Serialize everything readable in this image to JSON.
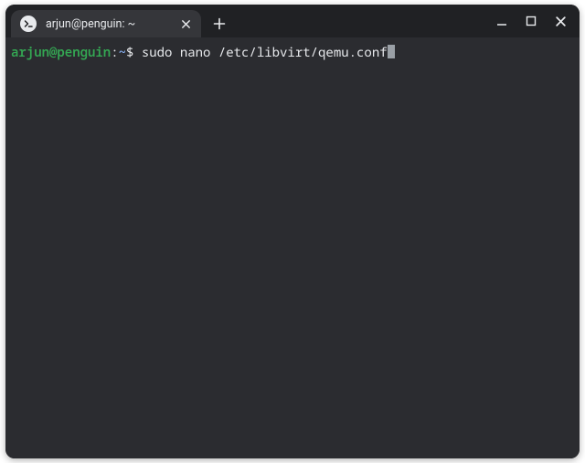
{
  "window": {
    "tab_title": "arjun@penguin: ~",
    "icon": "terminal-icon"
  },
  "terminal": {
    "prompt": {
      "user_host": "arjun@penguin",
      "separator": ":",
      "path": "~",
      "symbol": "$"
    },
    "command": "sudo nano /etc/libvirt/qemu.conf"
  },
  "colors": {
    "bg_window": "#202124",
    "bg_terminal": "#2b2c30",
    "fg": "#e8eaed",
    "prompt_green": "#34a853",
    "prompt_blue": "#8ab4f8",
    "cursor": "#9aa0a6"
  }
}
